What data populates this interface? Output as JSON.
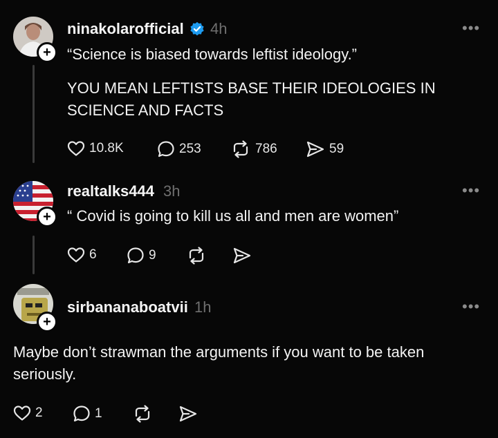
{
  "posts": [
    {
      "username": "ninakolarofficial",
      "time": "4h",
      "verified": true,
      "text1": "“Science is biased towards leftist ideology.”",
      "text2": "YOU MEAN LEFTISTS BASE THEIR IDEOLOGIES IN SCIENCE AND FACTS",
      "likes": "10.8K",
      "replies": "253",
      "reposts": "786",
      "shares": "59"
    },
    {
      "username": "realtalks444",
      "time": "3h",
      "text1": "“ Covid is going to kill us all and men are women”",
      "likes": "6",
      "replies": "9"
    },
    {
      "username": "sirbananaboatvii",
      "time": "1h",
      "text1": "Maybe don’t strawman the arguments if you want to be taken seriously.",
      "likes": "2",
      "replies": "1"
    }
  ],
  "icons": {
    "more": "more-icon",
    "like": "heart-icon",
    "reply": "comment-icon",
    "repost": "repost-icon",
    "share": "share-icon",
    "verified": "verified-badge-icon",
    "follow": "plus-icon"
  },
  "colors": {
    "background": "#070707",
    "verified": "#1d9bf0",
    "muted": "#6f6f6f"
  }
}
